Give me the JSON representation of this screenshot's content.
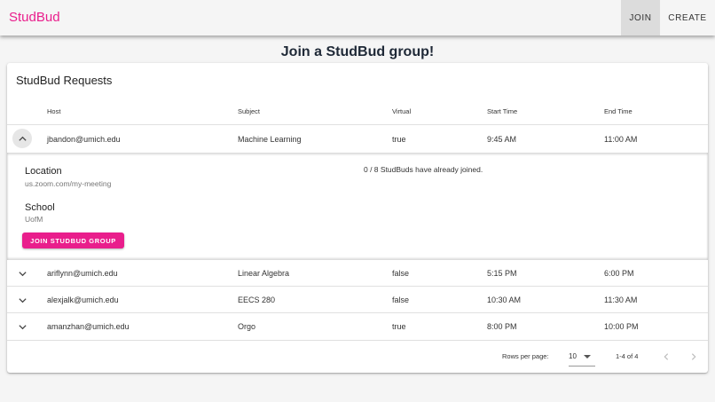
{
  "app": {
    "brand": "StudBud",
    "nav": {
      "join": "JOIN",
      "create": "CREATE"
    }
  },
  "page": {
    "title": "Join a StudBud group!"
  },
  "card": {
    "title": "StudBud Requests"
  },
  "table": {
    "headers": {
      "host": "Host",
      "subject": "Subject",
      "virtual": "Virtual",
      "start": "Start Time",
      "end": "End Time"
    },
    "rows": [
      {
        "host": "jbandon@umich.edu",
        "subject": "Machine Learning",
        "virtual": "true",
        "start": "9:45 AM",
        "end": "11:00 AM"
      },
      {
        "host": "ariflynn@umich.edu",
        "subject": "Linear Algebra",
        "virtual": "false",
        "start": "5:15 PM",
        "end": "6:00 PM"
      },
      {
        "host": "alexjalk@umich.edu",
        "subject": "EECS 280",
        "virtual": "false",
        "start": "10:30 AM",
        "end": "11:30 AM"
      },
      {
        "host": "amanzhan@umich.edu",
        "subject": "Orgo",
        "virtual": "true",
        "start": "8:00 PM",
        "end": "10:00 PM"
      }
    ]
  },
  "detail": {
    "location_label": "Location",
    "location_value": "us.zoom.com/my-meeting",
    "school_label": "School",
    "school_value": "UofM",
    "joined_text": "0 / 8 StudBuds have already joined.",
    "join_button": "JOIN STUDBUD GROUP"
  },
  "pagination": {
    "rows_per_page_label": "Rows per page:",
    "rows_per_page_value": "10",
    "range_text": "1-4 of 4"
  },
  "icons": {
    "expand": "chevron-down-icon",
    "collapse": "chevron-up-icon",
    "prev": "chevron-left-icon",
    "next": "chevron-right-icon"
  },
  "colors": {
    "accent": "#e91e8c"
  }
}
